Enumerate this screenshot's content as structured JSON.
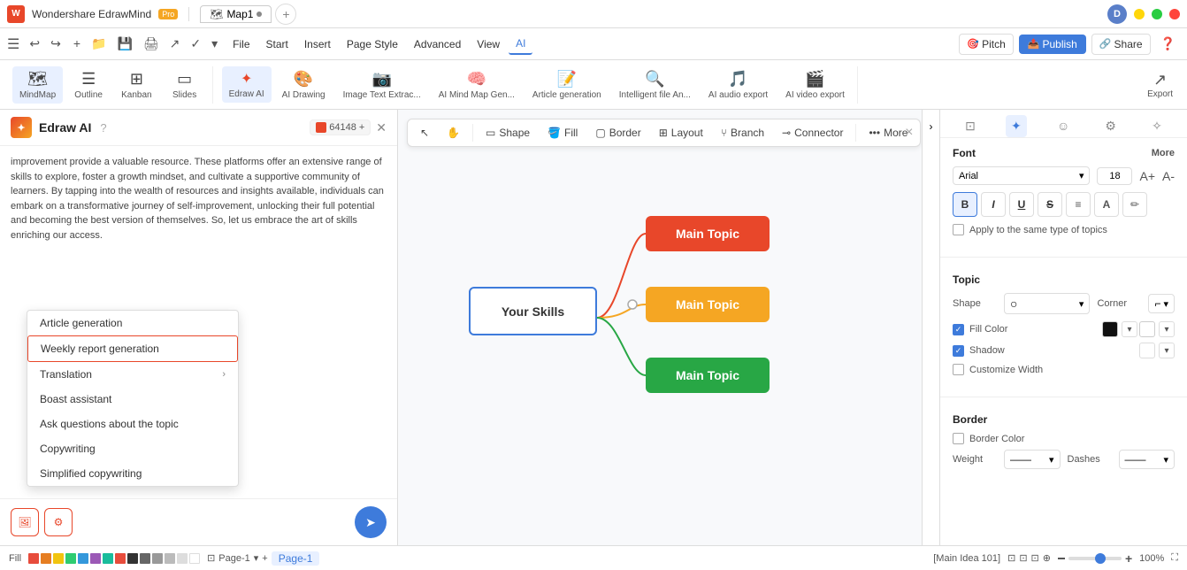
{
  "titleBar": {
    "appName": "Wondershare EdrawMind",
    "proBadge": "Pro",
    "tabs": [
      {
        "label": "Map1",
        "active": true,
        "dot": true
      }
    ],
    "avatar": "D"
  },
  "menuBar": {
    "items": [
      {
        "label": "File",
        "active": false
      },
      {
        "label": "Start",
        "active": false
      },
      {
        "label": "Insert",
        "active": false
      },
      {
        "label": "Page Style",
        "active": false
      },
      {
        "label": "Advanced",
        "active": false
      },
      {
        "label": "View",
        "active": false
      },
      {
        "label": "AI",
        "active": true
      }
    ],
    "pitch": "Pitch",
    "publish": "Publish",
    "share": "Share"
  },
  "toolbar": {
    "items": [
      {
        "label": "MindMap",
        "icon": "🗺"
      },
      {
        "label": "Outline",
        "icon": "☰"
      },
      {
        "label": "Kanban",
        "icon": "⊞"
      },
      {
        "label": "Slides",
        "icon": "▭"
      }
    ],
    "aiItems": [
      {
        "label": "Edraw AI",
        "icon": "✦"
      },
      {
        "label": "AI Drawing",
        "icon": "🎨"
      },
      {
        "label": "Image Text Extrac...",
        "icon": "📷"
      },
      {
        "label": "AI Mind Map Gen...",
        "icon": "🧠"
      },
      {
        "label": "Article generation",
        "icon": "📝"
      },
      {
        "label": "Intelligent file An...",
        "icon": "🔍"
      },
      {
        "label": "AI audio export",
        "icon": "🎵"
      },
      {
        "label": "AI video export",
        "icon": "🎬"
      }
    ],
    "exportLabel": "Export"
  },
  "aiPanel": {
    "title": "Edraw AI",
    "credits": "64148",
    "text": "improvement provide a valuable resource. These platforms offer an extensive range of skills to explore, foster a growth mindset, and cultivate a supportive community of learners. By tapping into the wealth of resources and insights available, individuals can embark on a transformative journey of self-improvement, unlocking their full potential and becoming the best version of themselves. So, let us embrace the art of skills enriching our access.",
    "dropdownItems": [
      {
        "label": "Article generation",
        "hasArrow": false,
        "selected": false
      },
      {
        "label": "Weekly report generation",
        "hasArrow": false,
        "selected": true
      },
      {
        "label": "Translation",
        "hasArrow": true,
        "selected": false
      },
      {
        "label": "Boast assistant",
        "hasArrow": false,
        "selected": false
      },
      {
        "label": "Ask questions about the topic",
        "hasArrow": false,
        "selected": false
      },
      {
        "label": "Copywriting",
        "hasArrow": false,
        "selected": false
      },
      {
        "label": "Simplified copywriting",
        "hasArrow": false,
        "selected": false
      }
    ]
  },
  "canvas": {
    "tools": [
      {
        "label": "Shape"
      },
      {
        "label": "Fill"
      },
      {
        "label": "Border"
      },
      {
        "label": "Layout"
      },
      {
        "label": "Branch"
      },
      {
        "label": "Connector"
      },
      {
        "label": "More"
      }
    ],
    "nodes": {
      "center": "Your Skills",
      "topic1": "Main Topic",
      "topic2": "Main Topic",
      "topic3": "Main Topic"
    }
  },
  "rightPanel": {
    "tabs": [
      "format",
      "style",
      "emoji",
      "shield",
      "sparkle"
    ],
    "font": {
      "sectionTitle": "Font",
      "moreLabel": "More",
      "family": "Arial",
      "size": "18",
      "bold": true,
      "italic": false,
      "underline": false,
      "strikethrough": false,
      "applyLabel": "Apply to the same type of topics"
    },
    "topic": {
      "sectionTitle": "Topic",
      "shapeLabel": "Shape",
      "cornerLabel": "Corner",
      "fillColorLabel": "Fill Color",
      "fillColorChecked": true,
      "shadowLabel": "Shadow",
      "shadowChecked": true,
      "customizeWidthLabel": "Customize Width",
      "customizeWidthChecked": false
    },
    "border": {
      "sectionTitle": "Border",
      "borderColorLabel": "Border Color",
      "borderColorChecked": false,
      "weightLabel": "Weight",
      "dashesLabel": "Dashes"
    }
  },
  "statusBar": {
    "fill": "Fill",
    "page": "Page-1",
    "currentPage": "Page-1",
    "status": "[Main Idea 101]",
    "zoom": "100%"
  }
}
